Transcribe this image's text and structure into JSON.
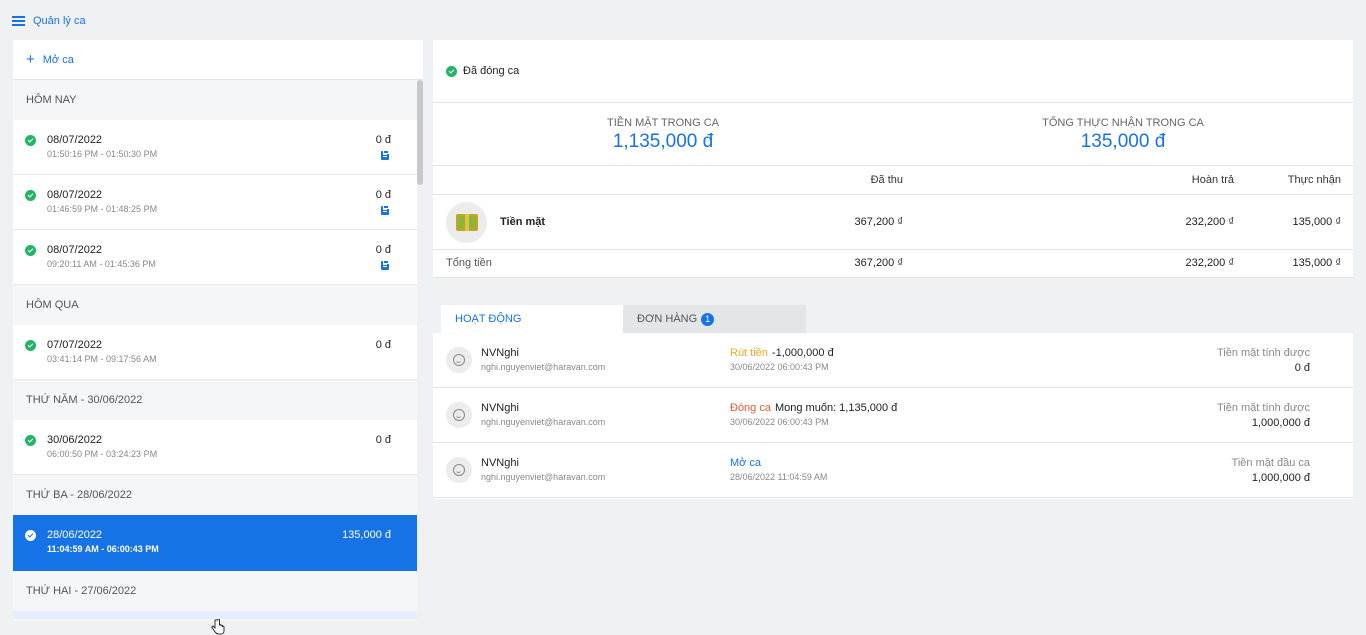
{
  "header": {
    "title": "Quản lý ca",
    "menu_icon": "hamburger-icon"
  },
  "sidebar": {
    "open_shift_label": "Mở ca",
    "groups": [
      {
        "title": "HÔM NAY",
        "items": [
          {
            "date": "08/07/2022",
            "time": "01:50:16 PM - 01:50:30 PM",
            "amount": "0 đ",
            "note": true
          },
          {
            "date": "08/07/2022",
            "time": "01:46:59 PM - 01:48:25 PM",
            "amount": "0 đ",
            "note": true
          },
          {
            "date": "08/07/2022",
            "time": "09:20:11 AM - 01:45:36 PM",
            "amount": "0 đ",
            "note": true
          }
        ]
      },
      {
        "title": "HÔM QUA",
        "items": [
          {
            "date": "07/07/2022",
            "time": "03:41:14 PM - 09:17:56 AM",
            "amount": "0 đ",
            "note": false
          }
        ]
      },
      {
        "title": "THỨ NĂM - 30/06/2022",
        "items": [
          {
            "date": "30/06/2022",
            "time": "06:00:50 PM - 03:24:23 PM",
            "amount": "0 đ",
            "note": false
          }
        ]
      },
      {
        "title": "THỨ BA - 28/06/2022",
        "items": [
          {
            "date": "28/06/2022",
            "time": "11:04:59 AM - 06:00:43 PM",
            "amount": "135,000 đ",
            "note": false,
            "active": true
          }
        ]
      },
      {
        "title": "THỨ HAI - 27/06/2022",
        "items": []
      }
    ]
  },
  "detail": {
    "status": "Đã đóng ca",
    "summary": {
      "cash_label": "TIỀN MẶT TRONG CA",
      "cash_value": "1,135,000 đ",
      "received_label": "TỔNG THỰC NHẬN TRONG CA",
      "received_value": "135,000 đ"
    },
    "payments": {
      "headers": {
        "collected": "Đã thu",
        "refunded": "Hoàn trả",
        "net": "Thực nhận"
      },
      "row": {
        "method": "Tiền mặt",
        "collected": "367,200 ₫",
        "refunded": "232,200 ₫",
        "net": "135,000 ₫"
      },
      "total": {
        "label": "Tổng tiền",
        "collected": "367,200 ₫",
        "refunded": "232,200 ₫",
        "net": "135,000 ₫"
      }
    },
    "tabs": {
      "activity": "HOẠT ĐỘNG",
      "orders": "ĐƠN HÀNG",
      "orders_badge": "1"
    },
    "activities": [
      {
        "name": "NVNghi",
        "email": "nghi.nguyenviet@haravan.com",
        "kind": "Rút tiền",
        "kind_color": "#f5a623",
        "detail": "-1,000,000 đ",
        "time": "30/06/2022 06:00:43 PM",
        "cash_label": "Tiền mặt tính được",
        "cash_value": "0 đ"
      },
      {
        "name": "NVNghi",
        "email": "nghi.nguyenviet@haravan.com",
        "kind": "Đóng ca",
        "kind_color": "#e8572e",
        "detail": "Mong muốn: 1,135,000 đ",
        "time": "30/06/2022 06:00:43 PM",
        "cash_label": "Tiền mặt tính được",
        "cash_value": "1,000,000 đ"
      },
      {
        "name": "NVNghi",
        "email": "nghi.nguyenviet@haravan.com",
        "kind": "Mở ca",
        "kind_color": "#1673e6",
        "detail": "",
        "time": "28/06/2022 11:04:59 AM",
        "cash_label": "Tiền mặt đầu ca",
        "cash_value": "1,000,000 đ"
      }
    ]
  }
}
